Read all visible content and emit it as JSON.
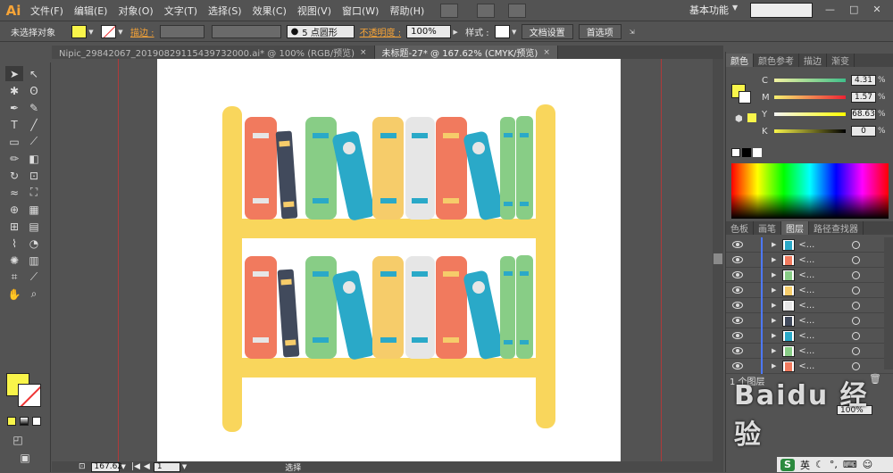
{
  "app": {
    "logo": "Ai"
  },
  "menu": [
    "文件(F)",
    "编辑(E)",
    "对象(O)",
    "文字(T)",
    "选择(S)",
    "效果(C)",
    "视图(V)",
    "窗口(W)",
    "帮助(H)"
  ],
  "workspace": "基本功能",
  "control": {
    "selection": "未选择对象",
    "fill_color": "#f9f54a",
    "stroke_label": "描边 :",
    "brush": "5 点圆形",
    "opacity_label": "不透明度 :",
    "opacity": "100%",
    "style_label": "样式 :",
    "doc_setup": "文档设置",
    "preferences": "首选项"
  },
  "tabs": [
    {
      "label": "Nipic_29842067_20190829115439732000.ai* @ 100% (RGB/预览)",
      "active": false
    },
    {
      "label": "未标题-27* @ 167.62% (CMYK/预览)",
      "active": true
    }
  ],
  "status": {
    "zoom": "167.62",
    "page": "1",
    "tool": "选择"
  },
  "color_panel": {
    "tabs": [
      "颜色",
      "颜色参考",
      "描边",
      "渐变"
    ],
    "channels": [
      {
        "name": "C",
        "value": "4.31",
        "pct": 0.0431
      },
      {
        "name": "M",
        "value": "1.57",
        "pct": 0.0157
      },
      {
        "name": "Y",
        "value": "68.63",
        "pct": 0.6863
      },
      {
        "name": "K",
        "value": "0",
        "pct": 0
      }
    ],
    "pct_sign": "%"
  },
  "layers_panel": {
    "tabs": [
      "色板",
      "画笔",
      "图层",
      "路径查找器"
    ],
    "rows": [
      "<...",
      "<...",
      "<...",
      "<...",
      "<...",
      "<...",
      "<...",
      "<...",
      "<..."
    ],
    "footer": "1 个图层",
    "opacity_value": "100%"
  },
  "watermark": "Baidu 经验",
  "tray": {
    "ime": "英"
  },
  "artwork": {
    "shelf_color": "#f9d65c",
    "books_colors": [
      "#f17a5e",
      "#414a5c",
      "#88cd86",
      "#2aa9c8",
      "#f6cc6a",
      "#e6e6e6",
      "#f17a5e",
      "#2aa9c8",
      "#88cd86"
    ]
  }
}
